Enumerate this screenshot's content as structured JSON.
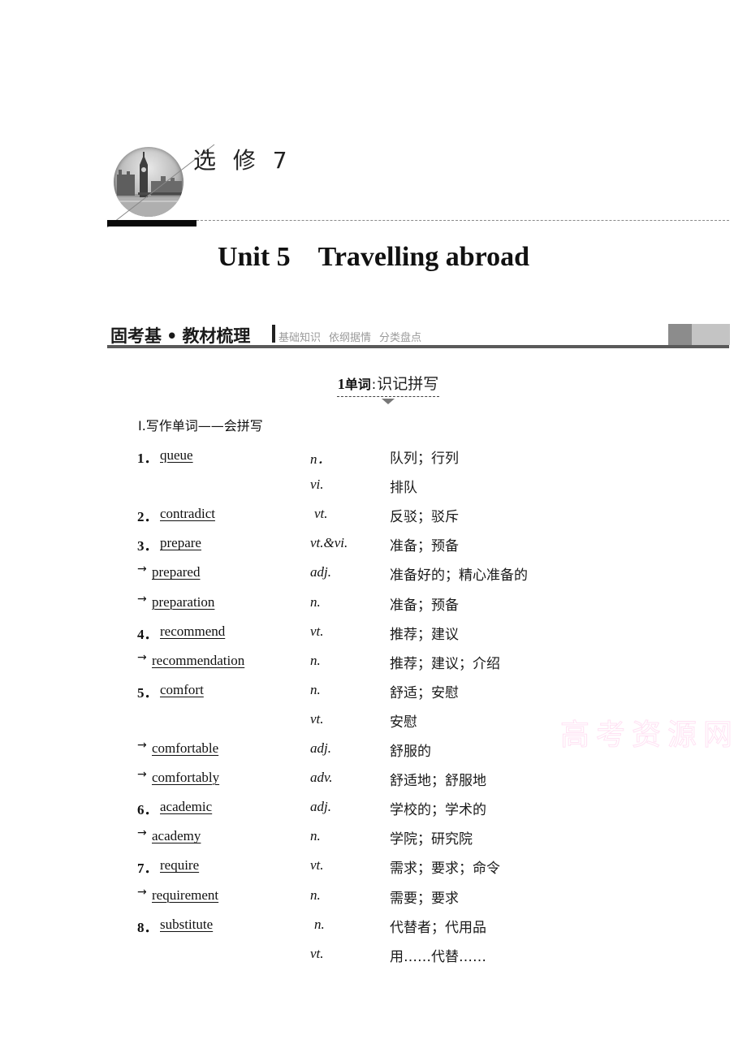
{
  "header": {
    "series_title": "选 修 7",
    "medallion_icon": "big-ben-medallion-icon"
  },
  "unit": {
    "number": "Unit 5",
    "title": "Travelling abroad"
  },
  "banner": {
    "main_left": "固考基",
    "main_dot": "•",
    "main_right": "教材梳理",
    "sub": [
      "基础知识",
      "依纲据情",
      "分类盘点"
    ]
  },
  "subheading": {
    "number": "1",
    "bold": "单词",
    "colon": ":",
    "light": "识记拼写"
  },
  "section_label": "Ⅰ.写作单词——会拼写",
  "vocab": [
    {
      "marker": "1．",
      "word": "queue",
      "pos": "n．",
      "meaning": "队列；行列"
    },
    {
      "marker": "",
      "word": "",
      "pos": "vi.",
      "meaning": "排队"
    },
    {
      "marker": "2．",
      "word": "contradict",
      "pos": "vt.",
      "meaning": "反驳；驳斥"
    },
    {
      "marker": "3．",
      "word": "prepare",
      "pos": "vt.&vi.",
      "meaning": "准备；预备"
    },
    {
      "marker": "→",
      "word": "prepared",
      "pos": "adj.",
      "meaning": "准备好的；精心准备的"
    },
    {
      "marker": "→",
      "word": "preparation",
      "pos": "n.",
      "meaning": "准备；预备"
    },
    {
      "marker": "4．",
      "word": "recommend",
      "pos": "vt.",
      "meaning": "推荐；建议"
    },
    {
      "marker": "→",
      "word": "recommendation",
      "pos": "n.",
      "meaning": "推荐；建议；介绍"
    },
    {
      "marker": "5．",
      "word": "comfort",
      "pos": "n.",
      "meaning": "舒适；安慰"
    },
    {
      "marker": "",
      "word": "",
      "pos": "vt.",
      "meaning": "安慰"
    },
    {
      "marker": "→",
      "word": "comfortable",
      "pos": "adj.",
      "meaning": "舒服的"
    },
    {
      "marker": "→",
      "word": "comfortably",
      "pos": "adv.",
      "meaning": "舒适地；舒服地"
    },
    {
      "marker": "6．",
      "word": "academic",
      "pos": "adj.",
      "meaning": "学校的；学术的"
    },
    {
      "marker": "→",
      "word": "academy",
      "pos": "n.",
      "meaning": "学院；研究院"
    },
    {
      "marker": "7．",
      "word": "require",
      "pos": "vt.",
      "meaning": "需求；要求；命令"
    },
    {
      "marker": "→",
      "word": "requirement",
      "pos": "n.",
      "meaning": "需要；要求"
    },
    {
      "marker": "8．",
      "word": "substitute",
      "pos": "n.",
      "meaning": "代替者；代用品"
    },
    {
      "marker": "",
      "word": "",
      "pos": "vt.",
      "meaning": "用……代替……"
    }
  ],
  "watermark": "高考资源网"
}
